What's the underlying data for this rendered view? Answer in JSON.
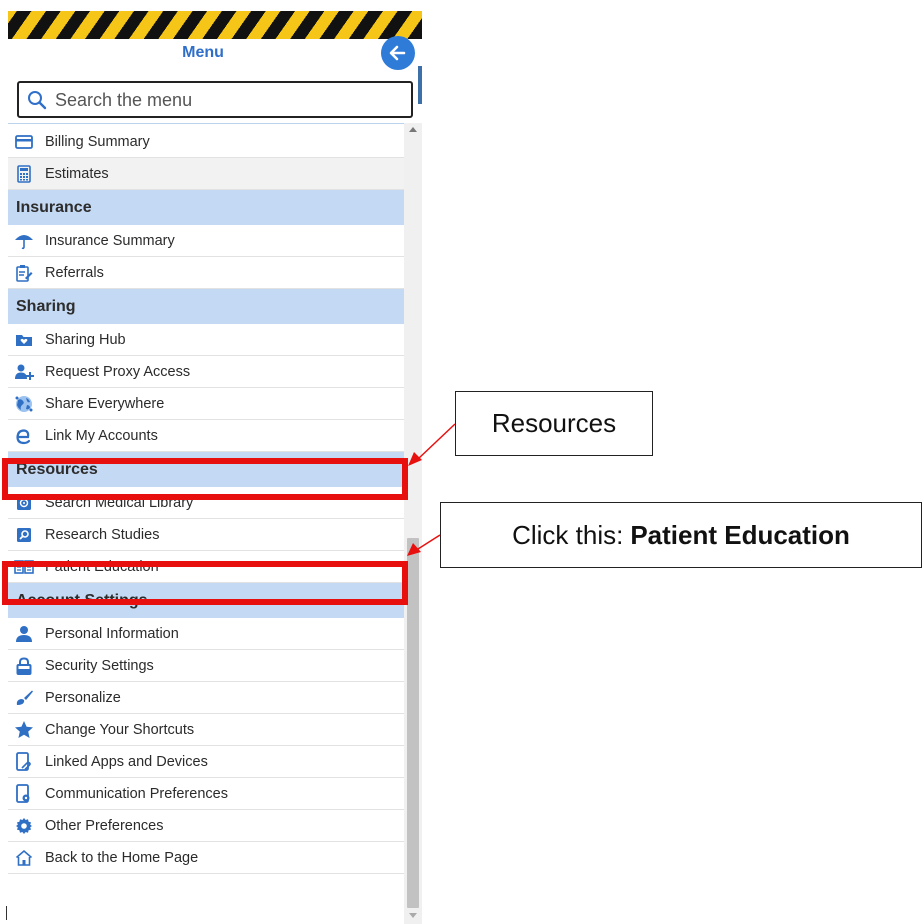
{
  "header": {
    "title": "Menu",
    "back_button_icon": "arrow-left-icon"
  },
  "search": {
    "placeholder": "Search the menu",
    "icon": "search-icon"
  },
  "menu": [
    {
      "kind": "item",
      "label": "Billing Summary",
      "icon": "credit-card-icon"
    },
    {
      "kind": "item",
      "label": "Estimates",
      "icon": "calculator-icon",
      "shaded": true
    },
    {
      "kind": "section",
      "label": "Insurance"
    },
    {
      "kind": "item",
      "label": "Insurance Summary",
      "icon": "umbrella-icon"
    },
    {
      "kind": "item",
      "label": "Referrals",
      "icon": "clipboard-icon"
    },
    {
      "kind": "section",
      "label": "Sharing"
    },
    {
      "kind": "item",
      "label": "Sharing Hub",
      "icon": "folder-heart-icon"
    },
    {
      "kind": "item",
      "label": "Request Proxy Access",
      "icon": "user-plus-icon"
    },
    {
      "kind": "item",
      "label": "Share Everywhere",
      "icon": "globe-icon"
    },
    {
      "kind": "item",
      "label": "Link My Accounts",
      "icon": "link-e-icon"
    },
    {
      "kind": "section",
      "label": "Resources"
    },
    {
      "kind": "item",
      "label": "Search Medical Library",
      "icon": "library-icon"
    },
    {
      "kind": "item",
      "label": "Research Studies",
      "icon": "microscope-icon"
    },
    {
      "kind": "item",
      "label": "Patient Education",
      "icon": "open-book-icon"
    },
    {
      "kind": "section",
      "label": "Account Settings"
    },
    {
      "kind": "item",
      "label": "Personal Information",
      "icon": "person-icon"
    },
    {
      "kind": "item",
      "label": "Security Settings",
      "icon": "lock-icon"
    },
    {
      "kind": "item",
      "label": "Personalize",
      "icon": "paintbrush-icon"
    },
    {
      "kind": "item",
      "label": "Change Your Shortcuts",
      "icon": "star-icon"
    },
    {
      "kind": "item",
      "label": "Linked Apps and Devices",
      "icon": "phone-link-icon"
    },
    {
      "kind": "item",
      "label": "Communication Preferences",
      "icon": "phone-gear-icon"
    },
    {
      "kind": "item",
      "label": "Other Preferences",
      "icon": "gear-icon"
    },
    {
      "kind": "item",
      "label": "Back to the Home Page",
      "icon": "home-icon"
    }
  ],
  "annotations": {
    "resources_callout": "Resources",
    "patient_education_prefix": "Click this:",
    "patient_education_bold": "Patient Education",
    "highlight_color": "#e8100f"
  },
  "colors": {
    "accent": "#2f6fca",
    "section_bg": "#c4d9f3",
    "icon_blue": "#2f6fc4"
  }
}
